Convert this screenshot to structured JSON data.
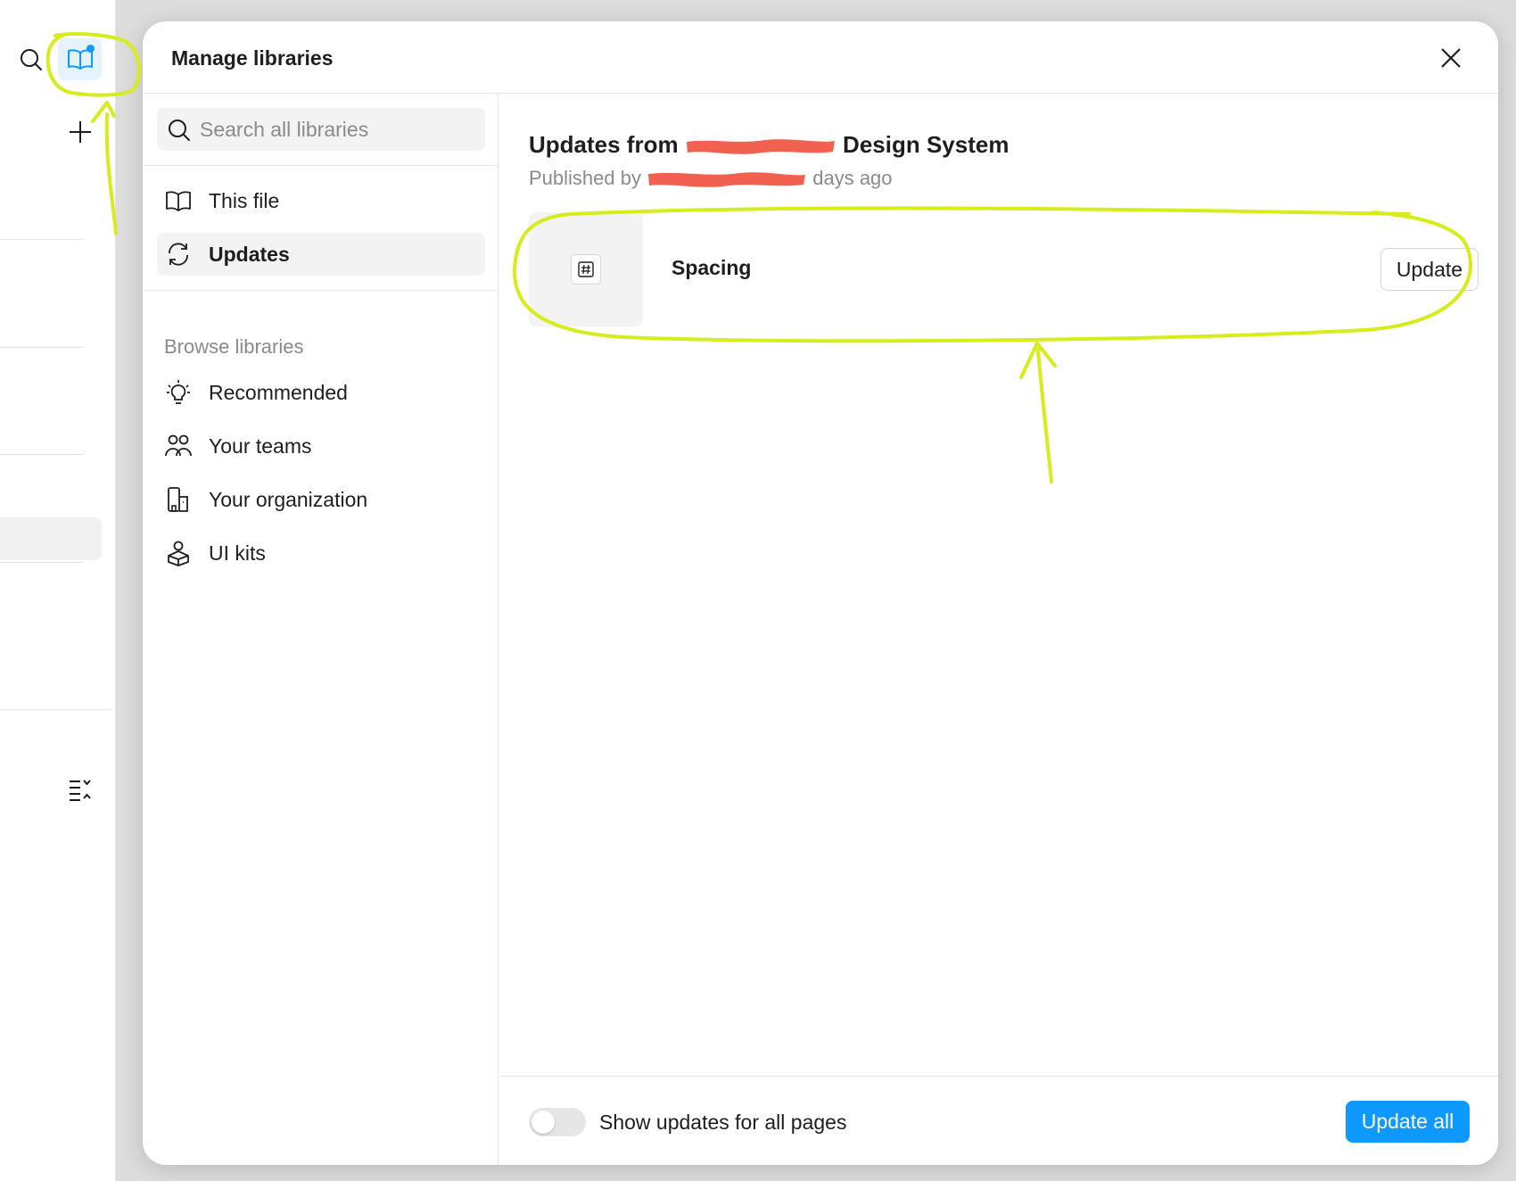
{
  "colors": {
    "accent": "#0d99ff",
    "annotation_highlight": "#d6ec1b",
    "redaction": "#f2604f"
  },
  "app_strip": {
    "icons": [
      "search-icon",
      "library-icon",
      "plus-icon",
      "sort-list-icon"
    ]
  },
  "modal": {
    "title": "Manage libraries"
  },
  "sidebar": {
    "search_placeholder": "Search all libraries",
    "items": [
      {
        "label": "This file",
        "icon": "book-icon"
      },
      {
        "label": "Updates",
        "icon": "sync-icon",
        "active": true
      }
    ],
    "browse_label": "Browse libraries",
    "browse_items": [
      {
        "label": "Recommended",
        "icon": "lightbulb-icon"
      },
      {
        "label": "Your teams",
        "icon": "people-icon"
      },
      {
        "label": "Your organization",
        "icon": "building-icon"
      },
      {
        "label": "UI kits",
        "icon": "cube-icon"
      }
    ]
  },
  "main": {
    "title_prefix": "Updates from",
    "title_suffix": "Design System",
    "subtitle_prefix": "Published by",
    "subtitle_suffix": "days ago",
    "updates": [
      {
        "name": "Spacing",
        "icon": "number-variable-icon",
        "button_label": "Update"
      }
    ],
    "footer": {
      "toggle_label": "Show updates for all pages",
      "toggle_on": false,
      "update_all_label": "Update all"
    }
  }
}
